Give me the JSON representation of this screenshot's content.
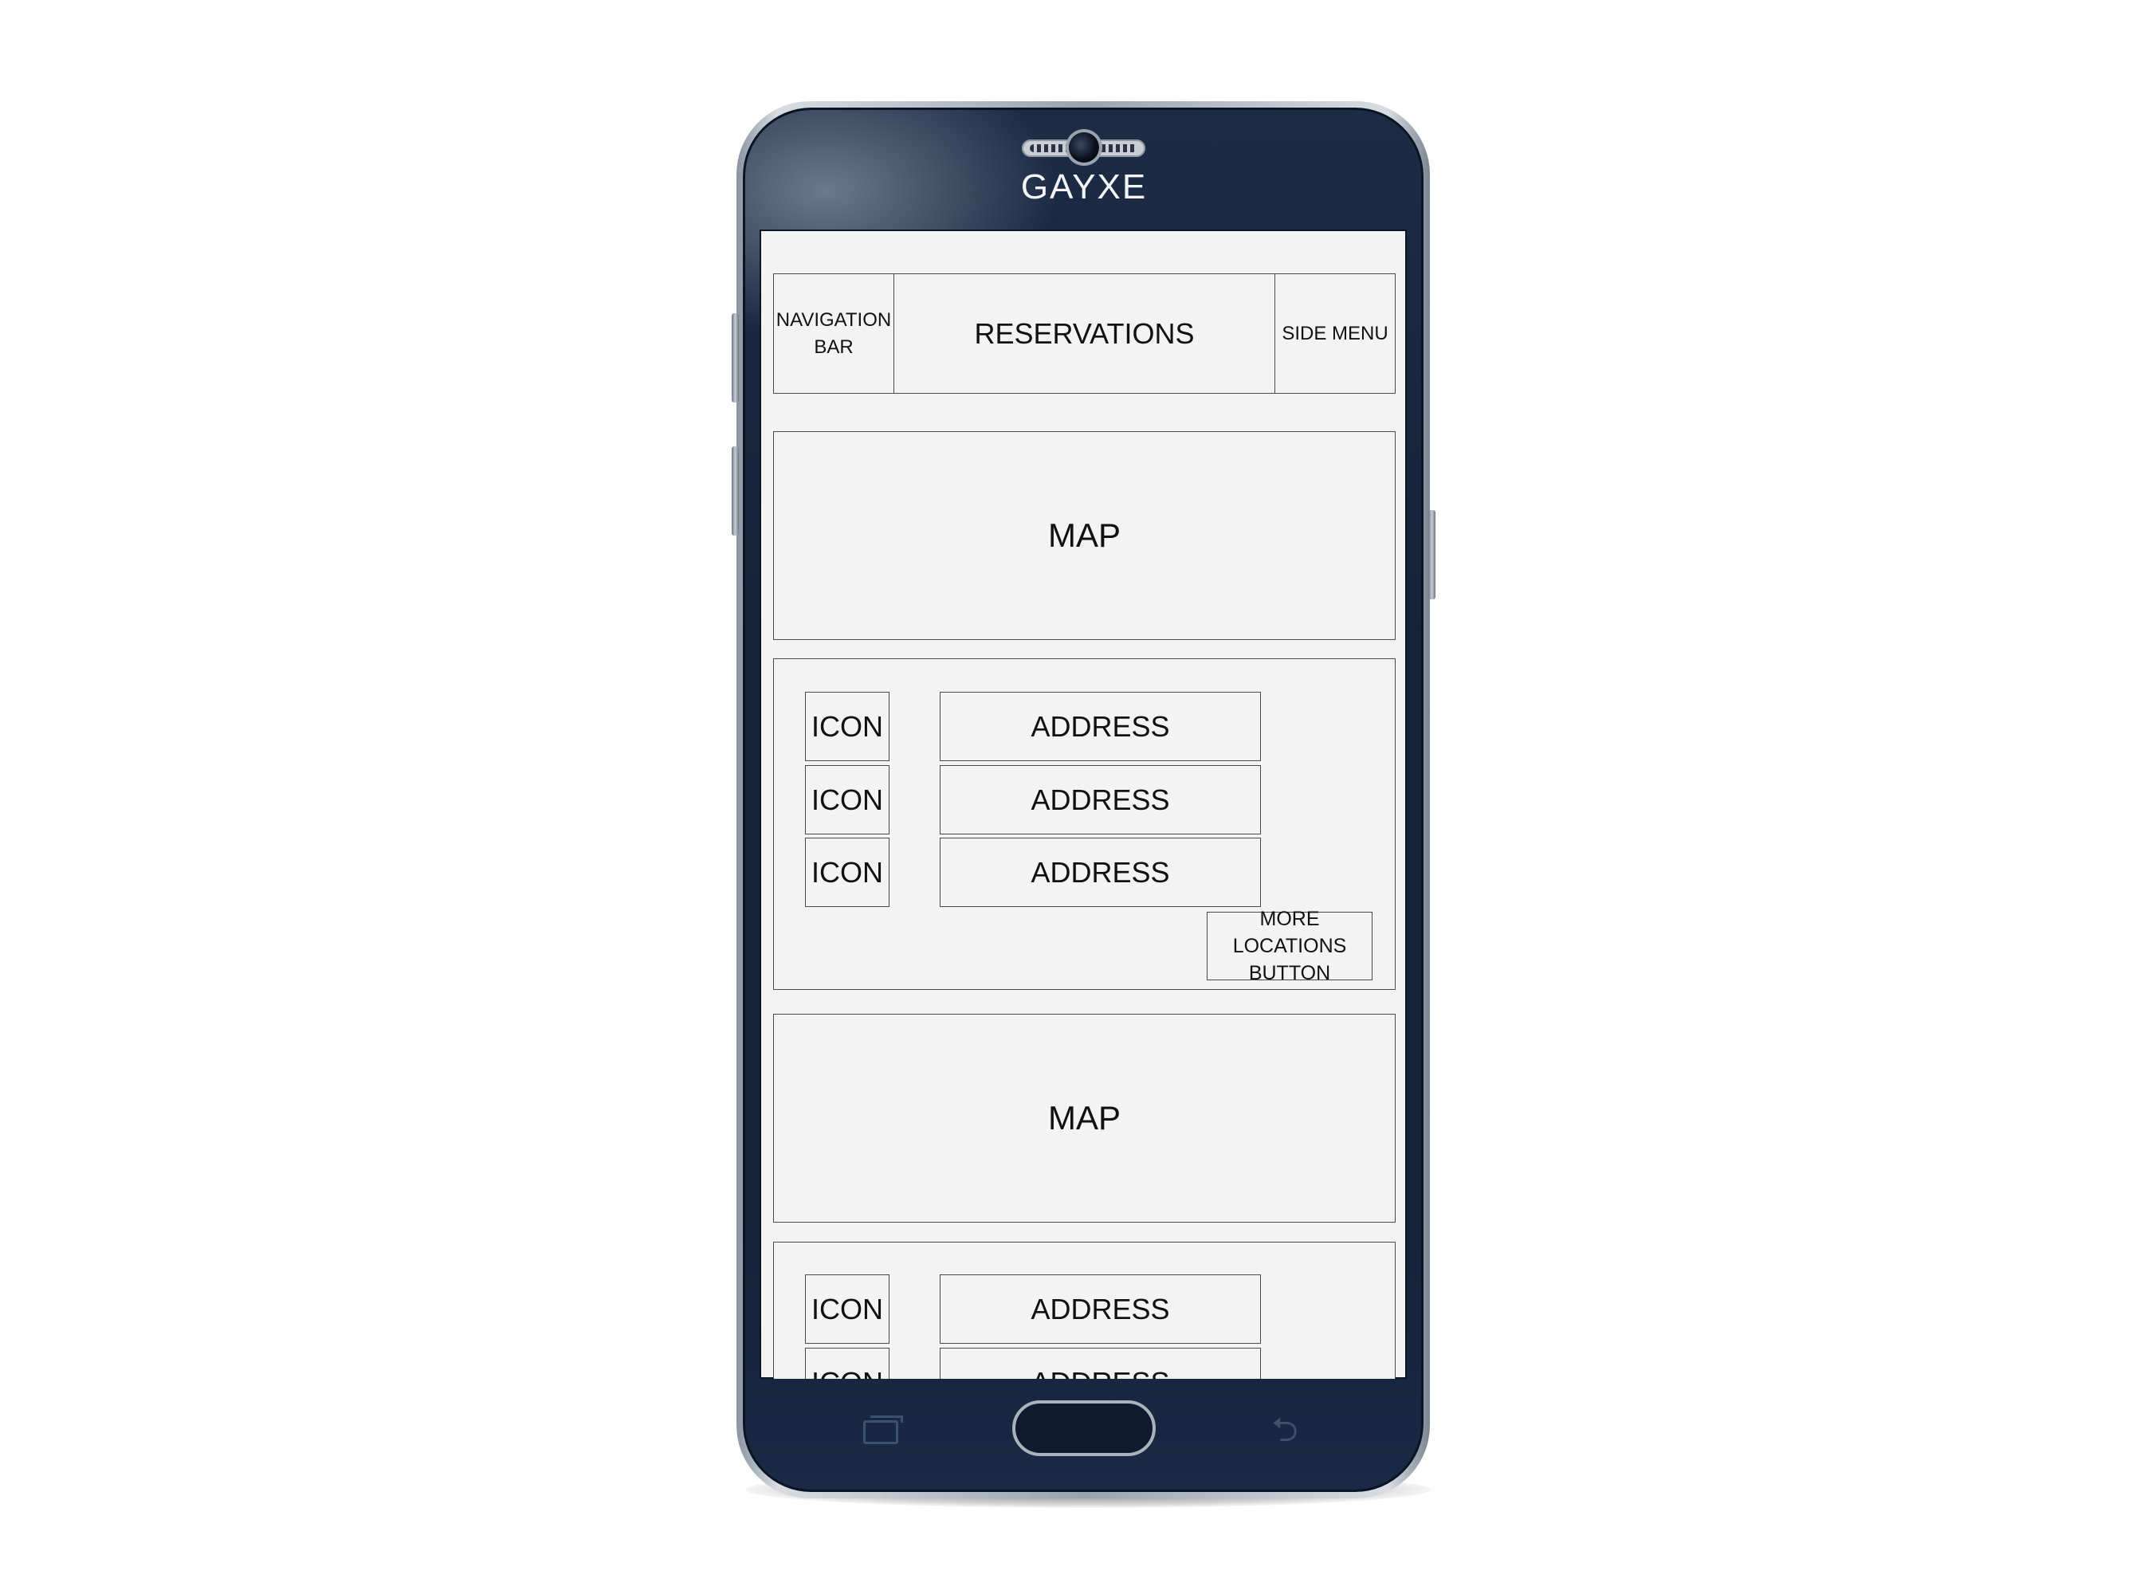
{
  "device": {
    "brand": "GAYXE"
  },
  "header": {
    "navigation_bar": "NAVIGATION\nBAR",
    "title": "RESERVATIONS",
    "side_menu": "SIDE MENU"
  },
  "sections": [
    {
      "map_label": "MAP",
      "locations": [
        {
          "icon": "ICON",
          "address": "ADDRESS"
        },
        {
          "icon": "ICON",
          "address": "ADDRESS"
        },
        {
          "icon": "ICON",
          "address": "ADDRESS"
        }
      ],
      "more_button": "MORE LOCATIONS\nBUTTON"
    },
    {
      "map_label": "MAP",
      "locations": [
        {
          "icon": "ICON",
          "address": "ADDRESS"
        },
        {
          "icon": "ICON",
          "address": "ADDRESS"
        }
      ]
    }
  ]
}
